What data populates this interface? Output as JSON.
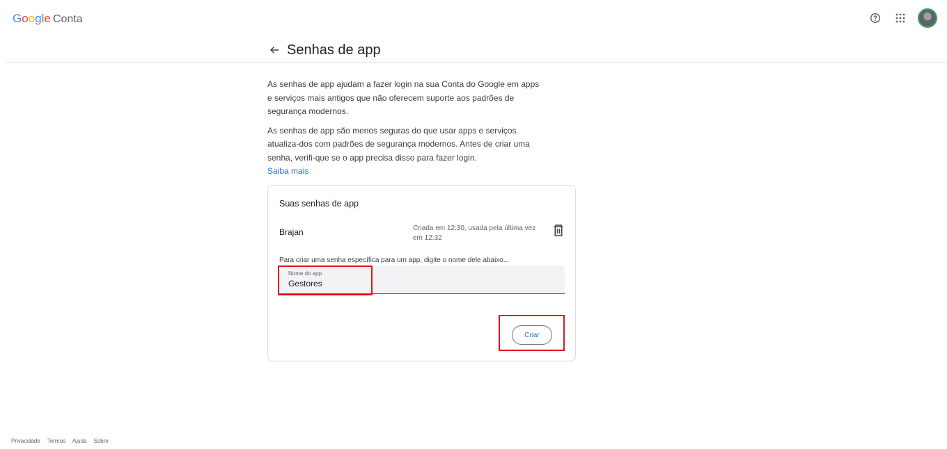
{
  "header": {
    "logo": {
      "G": "G",
      "o1": "o",
      "o2": "o",
      "g": "g",
      "l": "l",
      "e": "e",
      "product": "Conta"
    },
    "icons": [
      "help-icon",
      "apps-grid-icon"
    ],
    "avatar": "avatar"
  },
  "page": {
    "title": "Senhas de app",
    "intro_p1": "As senhas de app ajudam a fazer login na sua Conta do Google em apps e serviços mais antigos que não oferecem suporte aos padrões de segurança modernos.",
    "intro_p2": "As senhas de app são menos seguras do que usar apps e serviços atualiza-dos com padrões de segurança modernos. Antes de criar uma senha, verifi-que se o app precisa disso para fazer login.",
    "learn_more": "Saiba mais"
  },
  "card": {
    "title": "Suas senhas de app",
    "passwords": [
      {
        "name": "Brajan",
        "meta": "Criada em 12:30, usada pela última vez em 12:32"
      }
    ],
    "create_hint": "Para criar uma senha específica para um app, digite o nome dele abaixo...",
    "field": {
      "label": "Nome do app",
      "value": "Gestores"
    },
    "create_button": "Criar"
  },
  "footer": {
    "links": [
      "Privacidade",
      "Termos",
      "Ajuda",
      "Sobre"
    ]
  },
  "colors": {
    "accent": "#1a73e8",
    "highlight": "#e3131b"
  }
}
